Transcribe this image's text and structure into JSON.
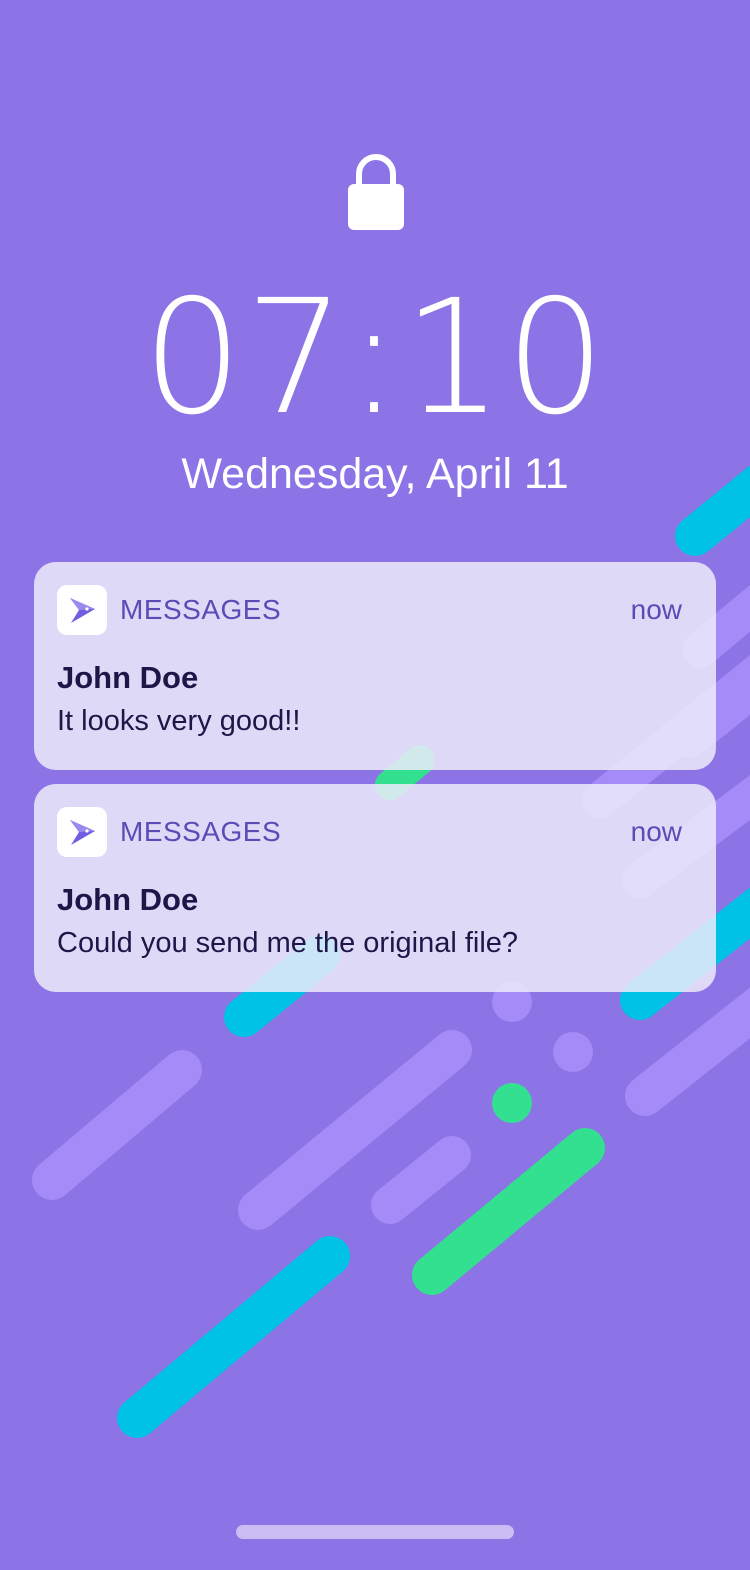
{
  "lock_screen": {
    "time": "07:10",
    "date": "Wednesday, April 11"
  },
  "notifications": [
    {
      "app": "MESSAGES",
      "time": "now",
      "sender": "John Doe",
      "message": "It looks very good!!"
    },
    {
      "app": "MESSAGES",
      "time": "now",
      "sender": "John Doe",
      "message": "Could you send me the original file?"
    }
  ],
  "icons": {
    "lock": "lock-icon",
    "app": "messages-app-icon"
  },
  "colors": {
    "background": "#8c73e6",
    "lavender_stripe": "#a48bf7",
    "cyan_stripe": "#00c2e6",
    "green_stripe": "#33e090",
    "notification_bg": "#ecebfa",
    "accent_text": "#5b4bb5"
  }
}
